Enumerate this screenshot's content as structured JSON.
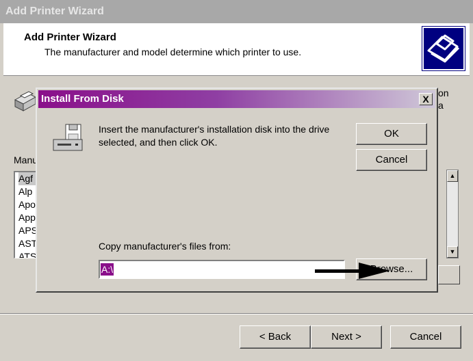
{
  "window": {
    "title": "Add Printer Wizard"
  },
  "header": {
    "title": "Add Printer Wizard",
    "subtitle": "The manufacturer and model determine which printer to use.",
    "icon": "printer-wizard-icon"
  },
  "background": {
    "description_fragment_line1": "on",
    "description_fragment_line2": "a",
    "list_label": "Manu",
    "manufacturers": [
      "Agf",
      "Alp",
      "Apo",
      "App",
      "APS",
      "AST",
      "ATS"
    ]
  },
  "footer": {
    "back_label": "< Back",
    "next_label": "Next >",
    "cancel_label": "Cancel"
  },
  "dialog": {
    "title": "Install From Disk",
    "close_label": "X",
    "message": "Insert the manufacturer's installation disk into the drive selected, and then click OK.",
    "ok_label": "OK",
    "cancel_label": "Cancel",
    "copy_label": "Copy manufacturer's files from:",
    "path_value": "A:\\",
    "browse_label": "Browse...",
    "title_gradient_start": "#8a0f8a"
  }
}
